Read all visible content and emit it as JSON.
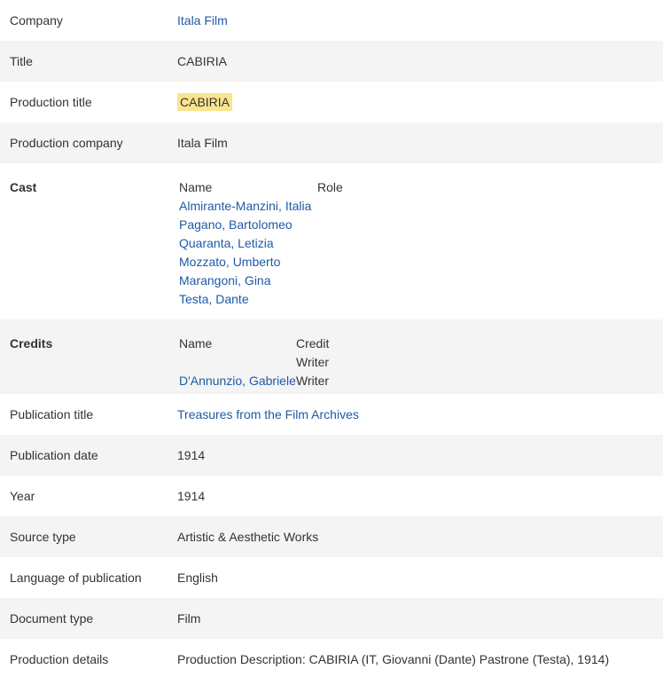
{
  "fields": {
    "company": {
      "label": "Company",
      "value": "Itala Film"
    },
    "title": {
      "label": "Title",
      "value": "CABIRIA"
    },
    "production_title": {
      "label": "Production title",
      "value": "CABIRIA"
    },
    "production_company": {
      "label": "Production company",
      "value": "Itala Film"
    },
    "cast": {
      "label": "Cast",
      "headers": {
        "name": "Name",
        "role": "Role"
      },
      "rows": [
        {
          "name": "Almirante-Manzini, Italia",
          "role": ""
        },
        {
          "name": "Pagano, Bartolomeo",
          "role": ""
        },
        {
          "name": "Quaranta, Letizia",
          "role": ""
        },
        {
          "name": "Mozzato, Umberto",
          "role": ""
        },
        {
          "name": "Marangoni, Gina",
          "role": ""
        },
        {
          "name": "Testa, Dante",
          "role": ""
        }
      ]
    },
    "credits": {
      "label": "Credits",
      "headers": {
        "name": "Name",
        "credit": "Credit"
      },
      "rows": [
        {
          "name": "",
          "credit": "Writer"
        },
        {
          "name": "D'Annunzio, Gabriele",
          "credit": "Writer"
        }
      ]
    },
    "publication_title": {
      "label": "Publication title",
      "value": "Treasures from the Film Archives"
    },
    "publication_date": {
      "label": "Publication date",
      "value": "1914"
    },
    "year": {
      "label": "Year",
      "value": "1914"
    },
    "source_type": {
      "label": "Source type",
      "value": "Artistic & Aesthetic Works"
    },
    "language": {
      "label": "Language of publication",
      "value": "English"
    },
    "document_type": {
      "label": "Document type",
      "value": "Film"
    },
    "production_details": {
      "label": "Production details",
      "value": "Production Description: CABIRIA (IT, Giovanni (Dante) Pastrone (Testa), 1914)"
    }
  },
  "colors": {
    "link": "#1f5aa6",
    "highlight": "#f8e58e",
    "row_shade": "#f4f4f4",
    "text": "#333333"
  }
}
